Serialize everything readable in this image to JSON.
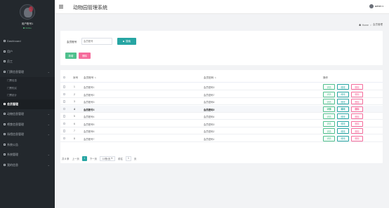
{
  "app": {
    "title": "动物园管理系统"
  },
  "profile": {
    "username": "用户账号1",
    "status": "Online"
  },
  "sidebar": {
    "items": [
      {
        "label": "Dashboard",
        "type": "item"
      },
      {
        "label": "用户",
        "type": "item"
      },
      {
        "label": "员工",
        "type": "item"
      },
      {
        "label": "门票信息管理",
        "type": "group"
      },
      {
        "label": "门票信息",
        "type": "sub"
      },
      {
        "label": "门票购买",
        "type": "sub"
      },
      {
        "label": "门票统计",
        "type": "sub"
      },
      {
        "label": "会员管理",
        "type": "active"
      },
      {
        "label": "动物信息管理",
        "type": "group"
      },
      {
        "label": "喂食信息管理",
        "type": "group"
      },
      {
        "label": "场馆信息管理",
        "type": "group"
      },
      {
        "label": "系统公告",
        "type": "item"
      },
      {
        "label": "系统管理",
        "type": "group"
      },
      {
        "label": "我的信息",
        "type": "group"
      }
    ]
  },
  "header": {
    "user": "admin"
  },
  "breadcrumb": {
    "home": "Home",
    "current": "会员管理"
  },
  "search": {
    "label": "会员账号",
    "placeholder": "会员账号",
    "button": "搜索",
    "add_button": "新增",
    "delete_button": "删除"
  },
  "table": {
    "headers": {
      "no": "序号",
      "name": "会员账号",
      "password": "会员密码",
      "ops": "操作"
    },
    "rows": [
      {
        "no": "1",
        "name": "会员账号1",
        "password": "会员密码3"
      },
      {
        "no": "2",
        "name": "会员账号2",
        "password": "会员密码7"
      },
      {
        "no": "3",
        "name": "会员账号3",
        "password": "会员密码6"
      },
      {
        "no": "4",
        "name": "会员账号3",
        "password": "会员密码5"
      },
      {
        "no": "5",
        "name": "会员账号4",
        "password": "会员密码4"
      },
      {
        "no": "6",
        "name": "会员账号5",
        "password": "会员密码3"
      },
      {
        "no": "7",
        "name": "会员账号6",
        "password": "会员密码2"
      },
      {
        "no": "8",
        "name": "会员账号7",
        "password": "会员密码1"
      }
    ],
    "highlight_row": 3,
    "op_labels": {
      "detail": "详情",
      "edit": "修改",
      "delete": "删除"
    }
  },
  "pagination": {
    "total": "共 8 条",
    "prev": "上一页",
    "current": "1",
    "next": "下一页",
    "page_size": "10条/页",
    "goto": "前往",
    "goto_value": "1",
    "page_unit": "页"
  },
  "colors": {
    "sidebar_bg": "#23282d",
    "primary": "#27a5a3",
    "success": "#4fc08d",
    "danger": "#f56c9c"
  },
  "icons": {
    "menu_toggle": "hamburger-icon",
    "search": "search-icon",
    "home": "home-icon"
  }
}
